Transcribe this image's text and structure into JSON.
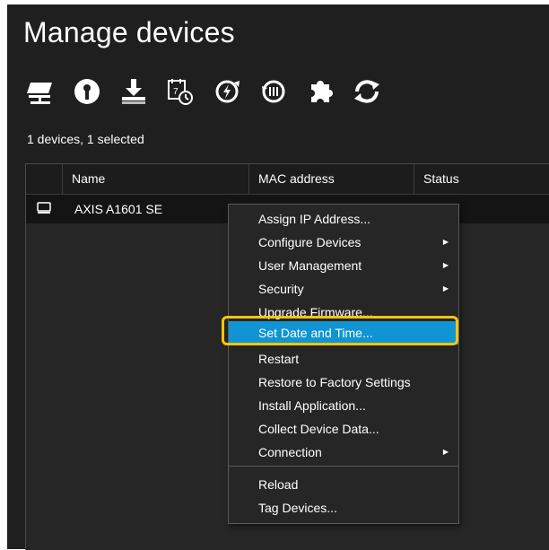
{
  "page": {
    "title": "Manage devices"
  },
  "toolbar": {
    "icons": [
      "add-device-icon",
      "password-key-icon",
      "download-install-icon",
      "set-date-time-icon",
      "firmware-upgrade-icon",
      "restore-icon",
      "install-app-plugin-icon",
      "reload-sync-icon"
    ]
  },
  "selection_info": "1 devices, 1 selected",
  "table": {
    "columns": [
      "Name",
      "MAC address",
      "Status"
    ],
    "rows": [
      {
        "name": "AXIS A1601 SE",
        "mac": "",
        "status": ""
      }
    ]
  },
  "context_menu": {
    "items": [
      {
        "label": "Assign IP Address...",
        "submenu": false
      },
      {
        "label": "Configure Devices",
        "submenu": true
      },
      {
        "label": "User Management",
        "submenu": true
      },
      {
        "label": "Security",
        "submenu": true
      },
      {
        "label": "Upgrade Firmware...",
        "submenu": false
      },
      {
        "label": "Set Date and Time...",
        "submenu": false,
        "highlighted": true
      },
      {
        "label": "Restart",
        "submenu": false
      },
      {
        "label": "Restore to Factory Settings",
        "submenu": false
      },
      {
        "label": "Install Application...",
        "submenu": false
      },
      {
        "label": "Collect Device Data...",
        "submenu": false
      },
      {
        "label": "Connection",
        "submenu": true
      },
      {
        "label": "Reload",
        "submenu": false
      },
      {
        "label": "Tag Devices...",
        "submenu": false
      }
    ],
    "submenu_arrow": "▶"
  },
  "colors": {
    "background": "#1f1f1f",
    "highlight": "#1094d3",
    "focus_ring": "#ffc40c"
  }
}
